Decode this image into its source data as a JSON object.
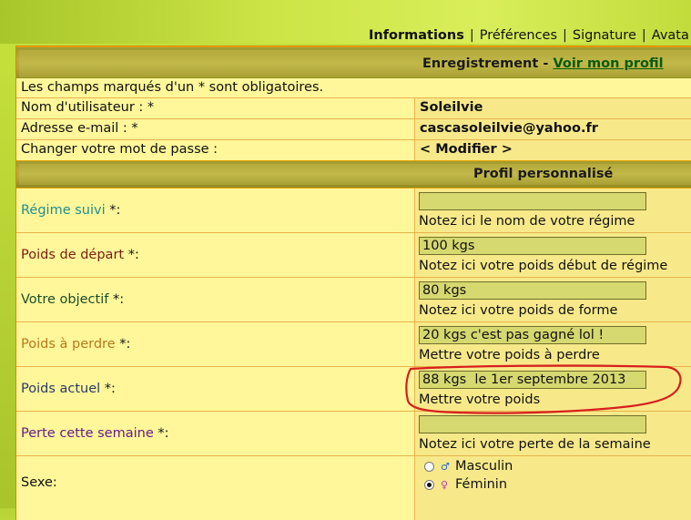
{
  "tabs": [
    "Informations",
    "Préférences",
    "Signature",
    "Avata"
  ],
  "registration": {
    "title": "Enregistrement",
    "separator": " - ",
    "link": "Voir mon profil",
    "required_note": "Les champs marqués d'un * sont obligatoires.",
    "rows": [
      {
        "label": "Nom d'utilisateur : *",
        "value": "Soleilvie"
      },
      {
        "label": "Adresse e-mail : *",
        "value": "cascasoleilvie@yahoo.fr"
      },
      {
        "label": "Changer votre mot de passe :",
        "value": "< Modifier >"
      }
    ]
  },
  "profile": {
    "title": "Profil personnalisé",
    "fields": [
      {
        "label": "Régime suivi",
        "suffix": " *:",
        "color": "#1f8f8f",
        "value": "",
        "hint": "Notez ici le nom de votre régime"
      },
      {
        "label": "Poids de départ",
        "suffix": " *:",
        "color": "#7a1e12",
        "value": "100 kgs",
        "hint": "Notez ici votre poids début de régime"
      },
      {
        "label": "Votre objectif",
        "suffix": " *:",
        "color": "#1a4d2a",
        "value": "80 kgs",
        "hint": "Notez ici votre poids de forme"
      },
      {
        "label": "Poids à perdre",
        "suffix": " *:",
        "color": "#b8781a",
        "value": "20 kgs c'est pas gagné lol !",
        "hint": "Mettre votre poids à perdre"
      },
      {
        "label": "Poids actuel",
        "suffix": " *:",
        "color": "#2a3a6a",
        "value": "88 kgs  le 1er septembre 2013",
        "hint": "Mettre votre poids"
      },
      {
        "label": "Perte cette semaine",
        "suffix": " *:",
        "color": "#6a1a8a",
        "value": "",
        "hint": "Notez ici votre perte de la semaine"
      }
    ],
    "sex": {
      "label": "Sexe:",
      "options": [
        {
          "label": "Masculin",
          "symbol": "♂",
          "symbol_color": "#2a6acc",
          "checked": false
        },
        {
          "label": "Féminin",
          "symbol": "♀",
          "symbol_color": "#c63ab0",
          "checked": true
        }
      ]
    }
  },
  "colors": {
    "annotation": "#d81e1e",
    "header": "#b4aa3c",
    "row": "#fff79a"
  }
}
